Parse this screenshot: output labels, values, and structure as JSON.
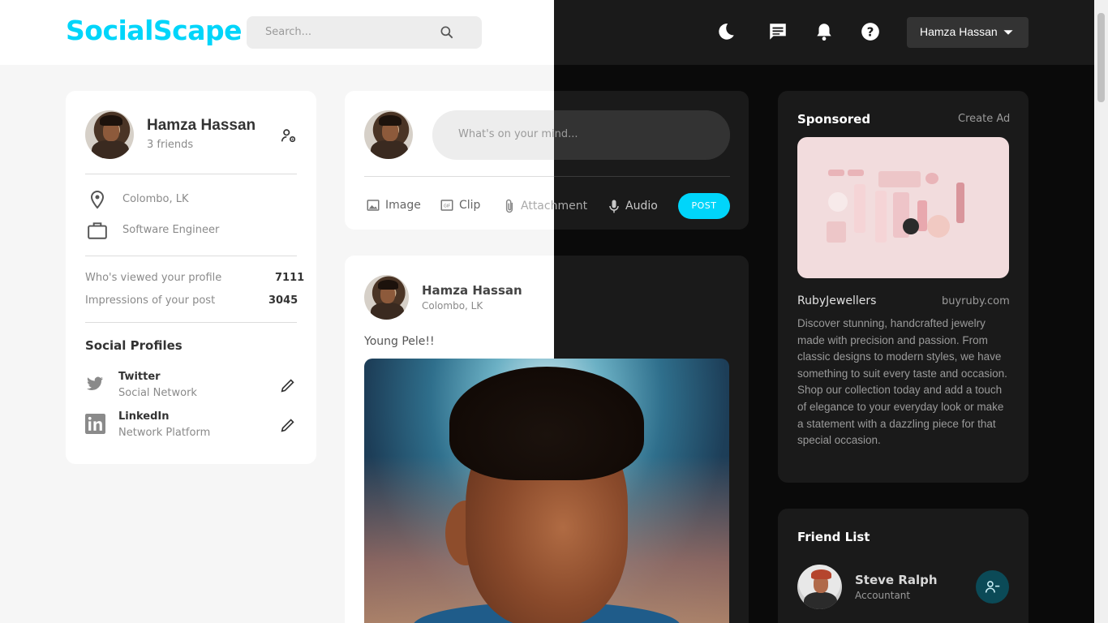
{
  "app": {
    "name": "SocialScape"
  },
  "search": {
    "placeholder": "Search..."
  },
  "header": {
    "user_name": "Hamza Hassan"
  },
  "profile": {
    "name": "Hamza Hassan",
    "friends": "3 friends",
    "location": "Colombo, LK",
    "occupation": "Software Engineer",
    "stats": [
      {
        "label": "Who's viewed your profile",
        "value": "7111"
      },
      {
        "label": "Impressions of your post",
        "value": "3045"
      }
    ],
    "social_title": "Social Profiles",
    "socials": [
      {
        "name": "Twitter",
        "type": "Social Network"
      },
      {
        "name": "LinkedIn",
        "type": "Network Platform"
      }
    ]
  },
  "composer": {
    "placeholder": "What's on your mind...",
    "actions": [
      "Image",
      "Clip",
      "Attachment",
      "Audio"
    ],
    "post_label": "POST"
  },
  "post": {
    "author": "Hamza Hassan",
    "location": "Colombo, LK",
    "caption": "Young Pele!!"
  },
  "sponsored": {
    "title": "Sponsored",
    "create_ad": "Create Ad",
    "brand": "RubyJewellers",
    "url": "buyruby.com",
    "description": "Discover stunning, handcrafted jewelry made with precision and passion. From classic designs to modern styles, we have something to suit every taste and occasion. Shop our collection today and add a touch of elegance to your everyday look or make a statement with a dazzling piece for that special occasion."
  },
  "friends": {
    "title": "Friend List",
    "items": [
      {
        "name": "Steve Ralph",
        "role": "Accountant"
      }
    ]
  },
  "colors": {
    "accent": "#00d5fa",
    "dark_card": "#1a1a1a",
    "light_card": "#ffffff"
  },
  "icons": [
    "search-icon",
    "moon-icon",
    "message-icon",
    "bell-icon",
    "help-icon",
    "caret-down-icon",
    "manage-accounts-icon",
    "location-icon",
    "briefcase-icon",
    "twitter-icon",
    "linkedin-icon",
    "edit-icon",
    "image-icon",
    "gif-icon",
    "attachment-icon",
    "mic-icon",
    "person-remove-icon"
  ]
}
